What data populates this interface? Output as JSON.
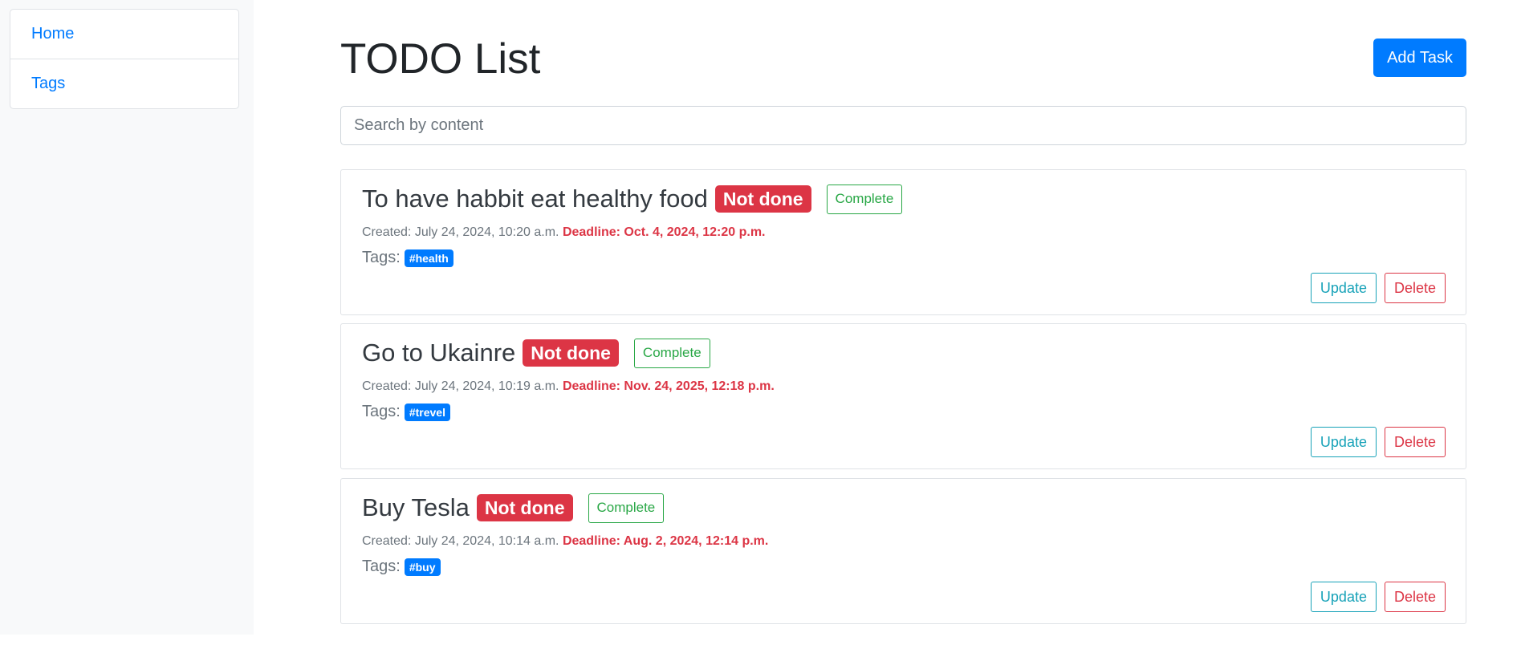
{
  "sidebar": {
    "items": [
      {
        "label": "Home"
      },
      {
        "label": "Tags"
      }
    ]
  },
  "header": {
    "title": "TODO List",
    "add_label": "Add Task"
  },
  "search": {
    "placeholder": "Search by content",
    "value": ""
  },
  "tasks": [
    {
      "title": "To have habbit eat healthy food",
      "status": "Not done",
      "complete_label": "Complete",
      "created": "Created: July 24, 2024, 10:20 a.m.",
      "deadline": "Deadline: Oct. 4, 2024, 12:20 p.m.",
      "tags_label": "Tags:",
      "tag": "#health",
      "update_label": "Update",
      "delete_label": "Delete"
    },
    {
      "title": "Go to Ukainre",
      "status": "Not done",
      "complete_label": "Complete",
      "created": "Created: July 24, 2024, 10:19 a.m.",
      "deadline": "Deadline: Nov. 24, 2025, 12:18 p.m.",
      "tags_label": "Tags:",
      "tag": "#trevel",
      "update_label": "Update",
      "delete_label": "Delete"
    },
    {
      "title": "Buy Tesla",
      "status": "Not done",
      "complete_label": "Complete",
      "created": "Created: July 24, 2024, 10:14 a.m.",
      "deadline": "Deadline: Aug. 2, 2024, 12:14 p.m.",
      "tags_label": "Tags:",
      "tag": "#buy",
      "update_label": "Update",
      "delete_label": "Delete"
    }
  ],
  "colors": {
    "primary": "#007bff",
    "danger": "#dc3545",
    "success": "#28a745",
    "info": "#17a2b8",
    "sidebar_bg": "#f8f9fa"
  }
}
